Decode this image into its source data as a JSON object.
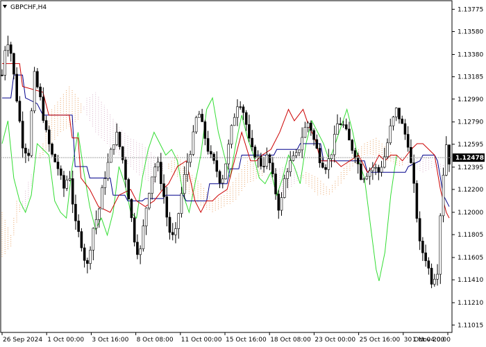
{
  "window": {
    "title": "GBPCHF,H4",
    "title_icon": "triangle-down-icon"
  },
  "colors": {
    "candle_bull": "#000000",
    "candle_bear": "#000000",
    "tenkan": "#cc0000",
    "kijun": "#00008b",
    "chikou": "#33dd33",
    "cloud_a": "#e8a060",
    "cloud_b": "#d8b0c8",
    "price_line": "#a0a0a0",
    "price_tag_bg": "#000000",
    "frame": "#000000"
  },
  "chart_data": {
    "type": "candlestick",
    "symbol": "GBPCHF",
    "timeframe": "H4",
    "indicator": "Ichimoku Kinko Hyo",
    "ylim": [
      1.1095,
      1.1385
    ],
    "y_ticks": [
      "1.13775",
      "1.13580",
      "1.13380",
      "1.13185",
      "1.12990",
      "1.12790",
      "1.12595",
      "1.12395",
      "1.12200",
      "1.12000",
      "1.11805",
      "1.11605",
      "1.11410",
      "1.11210",
      "1.11015"
    ],
    "x_ticks": [
      "26 Sep 2024",
      "1 Oct 00:00",
      "3 Oct 16:00",
      "8 Oct 08:00",
      "11 Oct 00:00",
      "15 Oct 16:00",
      "18 Oct 08:00",
      "23 Oct 00:00",
      "25 Oct 16:00",
      "30 Oct 04:00",
      "1 Nov 20:00"
    ],
    "current_price": "1.12478",
    "current_price_value": 1.12478,
    "close_path": [
      [
        0,
        1.132
      ],
      [
        3,
        1.1355
      ],
      [
        6,
        1.134
      ],
      [
        10,
        1.13
      ],
      [
        14,
        1.126
      ],
      [
        18,
        1.125
      ],
      [
        22,
        1.132
      ],
      [
        26,
        1.13
      ],
      [
        30,
        1.127
      ],
      [
        34,
        1.125
      ],
      [
        38,
        1.124
      ],
      [
        42,
        1.122
      ],
      [
        46,
        1.1235
      ],
      [
        50,
        1.119
      ],
      [
        54,
        1.1175
      ],
      [
        58,
        1.115
      ],
      [
        62,
        1.1185
      ],
      [
        66,
        1.12
      ],
      [
        70,
        1.123
      ],
      [
        74,
        1.125
      ],
      [
        78,
        1.127
      ],
      [
        82,
        1.125
      ],
      [
        86,
        1.122
      ],
      [
        90,
        1.118
      ],
      [
        94,
        1.116
      ],
      [
        98,
        1.12
      ],
      [
        102,
        1.123
      ],
      [
        106,
        1.1245
      ],
      [
        110,
        1.122
      ],
      [
        114,
        1.1185
      ],
      [
        118,
        1.1175
      ],
      [
        122,
        1.121
      ],
      [
        126,
        1.124
      ],
      [
        130,
        1.126
      ],
      [
        134,
        1.129
      ],
      [
        138,
        1.127
      ],
      [
        142,
        1.125
      ],
      [
        146,
        1.124
      ],
      [
        150,
        1.1225
      ],
      [
        154,
        1.125
      ],
      [
        158,
        1.128
      ],
      [
        162,
        1.13
      ],
      [
        166,
        1.1285
      ],
      [
        170,
        1.1255
      ],
      [
        174,
        1.125
      ],
      [
        178,
        1.124
      ],
      [
        182,
        1.125
      ],
      [
        186,
        1.1225
      ],
      [
        190,
        1.12
      ],
      [
        194,
        1.1235
      ],
      [
        198,
        1.1245
      ],
      [
        202,
        1.125
      ],
      [
        206,
        1.127
      ],
      [
        210,
        1.128
      ],
      [
        214,
        1.126
      ],
      [
        218,
        1.1245
      ],
      [
        222,
        1.124
      ],
      [
        226,
        1.1255
      ],
      [
        230,
        1.128
      ],
      [
        234,
        1.1275
      ],
      [
        238,
        1.126
      ],
      [
        242,
        1.125
      ],
      [
        246,
        1.123
      ],
      [
        250,
        1.1235
      ],
      [
        254,
        1.124
      ],
      [
        258,
        1.1235
      ],
      [
        262,
        1.125
      ],
      [
        266,
        1.1275
      ],
      [
        270,
        1.129
      ],
      [
        274,
        1.1275
      ],
      [
        278,
        1.126
      ],
      [
        282,
        1.122
      ],
      [
        286,
        1.117
      ],
      [
        290,
        1.116
      ],
      [
        294,
        1.114
      ],
      [
        298,
        1.115
      ],
      [
        300,
        1.12
      ],
      [
        302,
        1.1235
      ],
      [
        304,
        1.126
      ],
      [
        306,
        1.1245
      ]
    ],
    "candle_count": 153,
    "tenkan_path": [
      [
        0,
        1.133
      ],
      [
        12,
        1.133
      ],
      [
        14,
        1.131
      ],
      [
        28,
        1.1305
      ],
      [
        32,
        1.1285
      ],
      [
        46,
        1.1285
      ],
      [
        48,
        1.1265
      ],
      [
        52,
        1.1265
      ],
      [
        54,
        1.123
      ],
      [
        60,
        1.122
      ],
      [
        66,
        1.1205
      ],
      [
        74,
        1.12
      ],
      [
        80,
        1.1215
      ],
      [
        88,
        1.122
      ],
      [
        92,
        1.121
      ],
      [
        98,
        1.1205
      ],
      [
        104,
        1.121
      ],
      [
        110,
        1.122
      ],
      [
        114,
        1.1225
      ],
      [
        120,
        1.124
      ],
      [
        126,
        1.1245
      ],
      [
        132,
        1.121
      ],
      [
        136,
        1.12
      ],
      [
        140,
        1.121
      ],
      [
        144,
        1.121
      ],
      [
        148,
        1.1215
      ],
      [
        154,
        1.122
      ],
      [
        160,
        1.125
      ],
      [
        164,
        1.127
      ],
      [
        170,
        1.1245
      ],
      [
        174,
        1.1245
      ],
      [
        178,
        1.125
      ],
      [
        184,
        1.1255
      ],
      [
        190,
        1.127
      ],
      [
        196,
        1.129
      ],
      [
        200,
        1.128
      ],
      [
        206,
        1.129
      ],
      [
        210,
        1.1275
      ],
      [
        214,
        1.1265
      ],
      [
        218,
        1.1245
      ],
      [
        222,
        1.1245
      ],
      [
        228,
        1.1245
      ],
      [
        232,
        1.124
      ],
      [
        238,
        1.1245
      ],
      [
        244,
        1.125
      ],
      [
        250,
        1.1235
      ],
      [
        254,
        1.124
      ],
      [
        258,
        1.125
      ],
      [
        262,
        1.1245
      ],
      [
        266,
        1.125
      ],
      [
        270,
        1.125
      ],
      [
        274,
        1.1245
      ],
      [
        280,
        1.1255
      ],
      [
        284,
        1.126
      ],
      [
        288,
        1.126
      ],
      [
        292,
        1.1255
      ],
      [
        296,
        1.125
      ],
      [
        300,
        1.122
      ],
      [
        302,
        1.121
      ],
      [
        304,
        1.12
      ],
      [
        306,
        1.1195
      ]
    ],
    "kijun_path": [
      [
        0,
        1.13
      ],
      [
        6,
        1.13
      ],
      [
        8,
        1.132
      ],
      [
        14,
        1.132
      ],
      [
        16,
        1.13
      ],
      [
        24,
        1.1295
      ],
      [
        28,
        1.1285
      ],
      [
        34,
        1.1285
      ],
      [
        36,
        1.1285
      ],
      [
        48,
        1.1285
      ],
      [
        50,
        1.124
      ],
      [
        58,
        1.124
      ],
      [
        60,
        1.123
      ],
      [
        74,
        1.123
      ],
      [
        76,
        1.1215
      ],
      [
        84,
        1.1215
      ],
      [
        86,
        1.121
      ],
      [
        96,
        1.121
      ],
      [
        98,
        1.1212
      ],
      [
        110,
        1.1212
      ],
      [
        112,
        1.1215
      ],
      [
        124,
        1.1215
      ],
      [
        126,
        1.121
      ],
      [
        140,
        1.121
      ],
      [
        142,
        1.1225
      ],
      [
        154,
        1.1225
      ],
      [
        156,
        1.1238
      ],
      [
        162,
        1.1238
      ],
      [
        164,
        1.125
      ],
      [
        186,
        1.125
      ],
      [
        188,
        1.1255
      ],
      [
        202,
        1.1255
      ],
      [
        204,
        1.126
      ],
      [
        218,
        1.126
      ],
      [
        220,
        1.1245
      ],
      [
        232,
        1.1245
      ],
      [
        234,
        1.1245
      ],
      [
        248,
        1.1245
      ],
      [
        250,
        1.1235
      ],
      [
        262,
        1.1235
      ],
      [
        264,
        1.1235
      ],
      [
        276,
        1.1235
      ],
      [
        278,
        1.124
      ],
      [
        286,
        1.1245
      ],
      [
        288,
        1.125
      ],
      [
        296,
        1.125
      ],
      [
        298,
        1.1245
      ],
      [
        302,
        1.1215
      ],
      [
        306,
        1.1205
      ]
    ],
    "chikou_path": [
      [
        0,
        1.126
      ],
      [
        4,
        1.128
      ],
      [
        8,
        1.123
      ],
      [
        12,
        1.121
      ],
      [
        16,
        1.12
      ],
      [
        20,
        1.1215
      ],
      [
        24,
        1.126
      ],
      [
        28,
        1.1255
      ],
      [
        32,
        1.125
      ],
      [
        36,
        1.121
      ],
      [
        40,
        1.12
      ],
      [
        44,
        1.1195
      ],
      [
        48,
        1.124
      ],
      [
        52,
        1.127
      ],
      [
        56,
        1.1235
      ],
      [
        60,
        1.1205
      ],
      [
        64,
        1.1185
      ],
      [
        68,
        1.1195
      ],
      [
        72,
        1.118
      ],
      [
        76,
        1.12
      ],
      [
        80,
        1.124
      ],
      [
        84,
        1.1225
      ],
      [
        88,
        1.12
      ],
      [
        92,
        1.1195
      ],
      [
        96,
        1.123
      ],
      [
        100,
        1.1255
      ],
      [
        104,
        1.127
      ],
      [
        108,
        1.126
      ],
      [
        112,
        1.125
      ],
      [
        116,
        1.1255
      ],
      [
        120,
        1.1245
      ],
      [
        124,
        1.1215
      ],
      [
        128,
        1.12
      ],
      [
        132,
        1.1225
      ],
      [
        136,
        1.125
      ],
      [
        140,
        1.129
      ],
      [
        144,
        1.13
      ],
      [
        148,
        1.127
      ],
      [
        152,
        1.125
      ],
      [
        156,
        1.123
      ],
      [
        160,
        1.126
      ],
      [
        164,
        1.1285
      ],
      [
        168,
        1.1265
      ],
      [
        172,
        1.125
      ],
      [
        176,
        1.123
      ],
      [
        180,
        1.1225
      ],
      [
        184,
        1.1235
      ],
      [
        188,
        1.1215
      ],
      [
        192,
        1.123
      ],
      [
        196,
        1.125
      ],
      [
        200,
        1.124
      ],
      [
        204,
        1.1225
      ],
      [
        208,
        1.126
      ],
      [
        212,
        1.128
      ],
      [
        216,
        1.127
      ],
      [
        220,
        1.126
      ],
      [
        224,
        1.1245
      ],
      [
        228,
        1.126
      ],
      [
        232,
        1.1275
      ],
      [
        236,
        1.129
      ],
      [
        240,
        1.127
      ],
      [
        244,
        1.1245
      ],
      [
        248,
        1.123
      ],
      [
        252,
        1.119
      ],
      [
        256,
        1.115
      ],
      [
        258,
        1.114
      ],
      [
        262,
        1.1165
      ],
      [
        266,
        1.1215
      ],
      [
        270,
        1.125
      ]
    ],
    "span_a_path": [
      [
        0,
        1.12
      ],
      [
        6,
        1.118
      ],
      [
        10,
        1.121
      ],
      [
        16,
        1.12
      ],
      [
        22,
        1.1235
      ],
      [
        28,
        1.126
      ],
      [
        34,
        1.129
      ],
      [
        40,
        1.13
      ],
      [
        46,
        1.131
      ],
      [
        52,
        1.13
      ],
      [
        58,
        1.1285
      ],
      [
        64,
        1.127
      ],
      [
        72,
        1.126
      ],
      [
        80,
        1.125
      ],
      [
        88,
        1.124
      ],
      [
        96,
        1.123
      ],
      [
        104,
        1.1225
      ],
      [
        112,
        1.124
      ],
      [
        120,
        1.125
      ],
      [
        128,
        1.1235
      ],
      [
        136,
        1.1225
      ],
      [
        144,
        1.121
      ],
      [
        152,
        1.1215
      ],
      [
        160,
        1.123
      ],
      [
        168,
        1.1245
      ],
      [
        176,
        1.124
      ],
      [
        184,
        1.1225
      ],
      [
        192,
        1.1215
      ],
      [
        200,
        1.1225
      ],
      [
        208,
        1.1235
      ],
      [
        216,
        1.123
      ],
      [
        224,
        1.122
      ],
      [
        232,
        1.1235
      ],
      [
        240,
        1.125
      ],
      [
        248,
        1.126
      ],
      [
        256,
        1.1265
      ],
      [
        264,
        1.1255
      ],
      [
        272,
        1.1245
      ],
      [
        280,
        1.124
      ],
      [
        288,
        1.1235
      ],
      [
        296,
        1.124
      ],
      [
        306,
        1.1235
      ]
    ],
    "span_b_path": [
      [
        0,
        1.116
      ],
      [
        6,
        1.117
      ],
      [
        10,
        1.119
      ],
      [
        16,
        1.122
      ],
      [
        22,
        1.124
      ],
      [
        28,
        1.125
      ],
      [
        34,
        1.126
      ],
      [
        40,
        1.127
      ],
      [
        46,
        1.1275
      ],
      [
        52,
        1.128
      ],
      [
        58,
        1.13
      ],
      [
        64,
        1.1305
      ],
      [
        72,
        1.129
      ],
      [
        80,
        1.1275
      ],
      [
        88,
        1.1265
      ],
      [
        96,
        1.126
      ],
      [
        104,
        1.125
      ],
      [
        112,
        1.124
      ],
      [
        120,
        1.123
      ],
      [
        128,
        1.1215
      ],
      [
        136,
        1.1205
      ],
      [
        144,
        1.12
      ],
      [
        152,
        1.1205
      ],
      [
        160,
        1.121
      ],
      [
        168,
        1.1225
      ],
      [
        176,
        1.123
      ],
      [
        184,
        1.1235
      ],
      [
        192,
        1.124
      ],
      [
        200,
        1.124
      ],
      [
        208,
        1.1225
      ],
      [
        216,
        1.1215
      ],
      [
        224,
        1.1215
      ],
      [
        232,
        1.1225
      ],
      [
        240,
        1.124
      ],
      [
        248,
        1.125
      ],
      [
        256,
        1.125
      ],
      [
        264,
        1.1245
      ],
      [
        272,
        1.124
      ],
      [
        280,
        1.1245
      ],
      [
        288,
        1.125
      ],
      [
        296,
        1.1245
      ],
      [
        306,
        1.124
      ]
    ]
  }
}
